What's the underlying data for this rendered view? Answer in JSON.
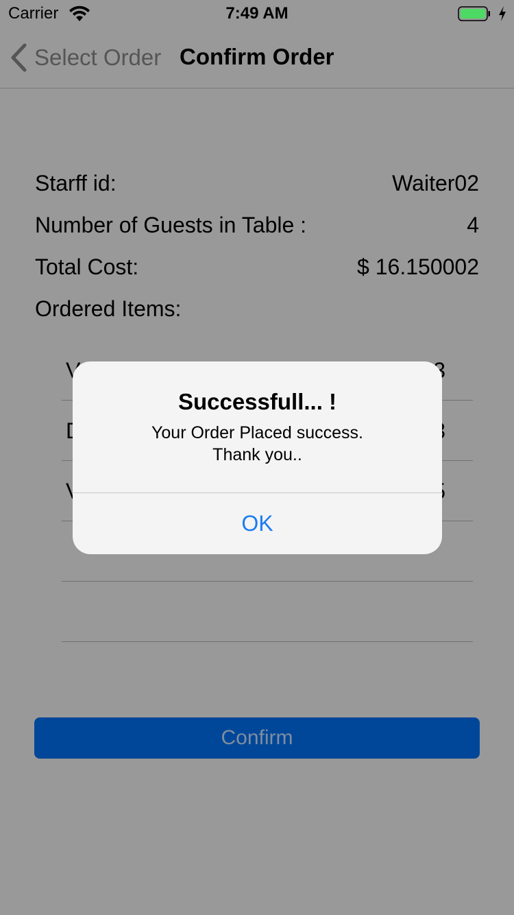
{
  "status_bar": {
    "carrier": "Carrier",
    "time": "7:49 AM",
    "battery_color": "#4cd964"
  },
  "nav": {
    "back_label": "Select Order",
    "title": "Confirm Order"
  },
  "details": {
    "staff_label": "Starff id:",
    "staff_value": "Waiter02",
    "guests_label": "Number of Guests in Table :",
    "guests_value": "4",
    "cost_label": "Total Cost:",
    "cost_value": "$ 16.150002",
    "items_label": "Ordered Items:"
  },
  "ordered_items": [
    {
      "name": "V",
      "qty": "3"
    },
    {
      "name": "D",
      "qty": "3"
    },
    {
      "name": "V",
      "qty": "5"
    },
    {
      "name": "",
      "qty": ""
    },
    {
      "name": "",
      "qty": ""
    }
  ],
  "confirm_button": {
    "label": "Confirm",
    "color": "#004799"
  },
  "alert": {
    "title": "Successfull... !",
    "message_line1": "Your Order Placed success.",
    "message_line2": "Thank you..",
    "ok_label": "OK",
    "ok_color": "#1a7cf2"
  }
}
